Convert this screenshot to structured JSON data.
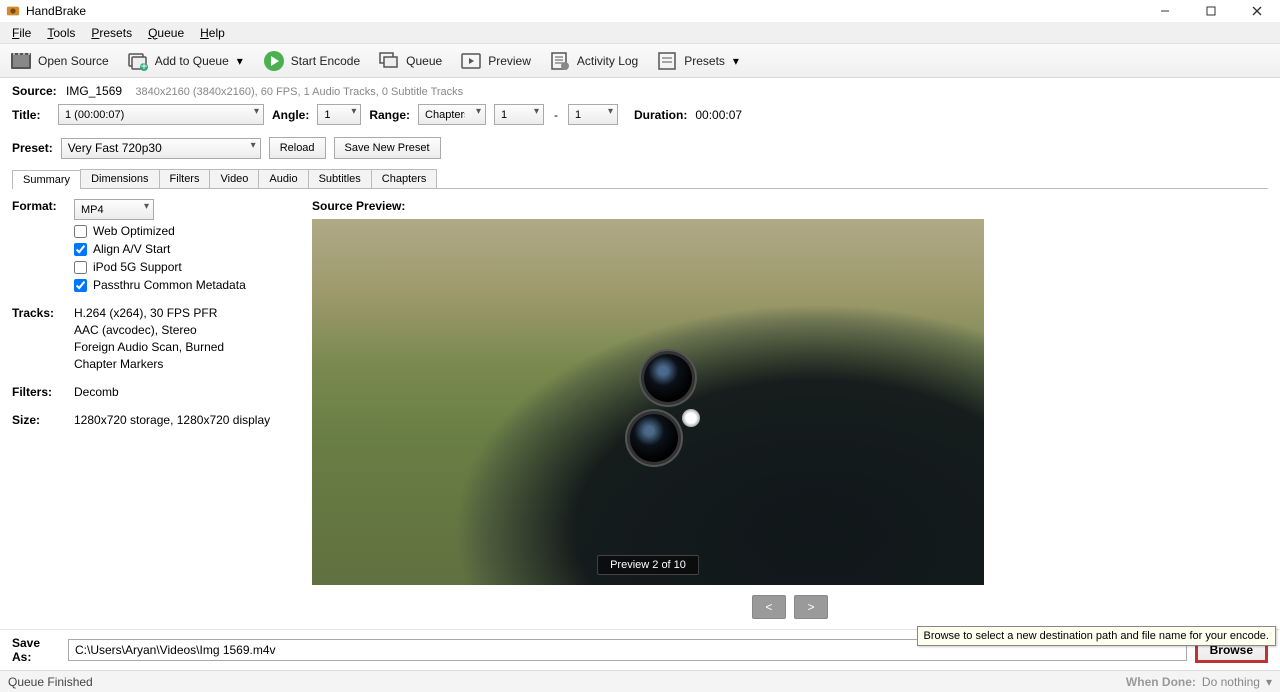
{
  "app": {
    "title": "HandBrake"
  },
  "menu": {
    "file": "File",
    "tools": "Tools",
    "presets": "Presets",
    "queue": "Queue",
    "help": "Help"
  },
  "toolbar": {
    "open_source": "Open Source",
    "add_to_queue": "Add to Queue",
    "start_encode": "Start Encode",
    "queue": "Queue",
    "preview": "Preview",
    "activity_log": "Activity Log",
    "presets": "Presets"
  },
  "source": {
    "label": "Source:",
    "file": "IMG_1569",
    "meta": "3840x2160 (3840x2160), 60 FPS, 1 Audio Tracks, 0 Subtitle Tracks"
  },
  "title_row": {
    "title_label": "Title:",
    "title_value": "1  (00:00:07)",
    "angle_label": "Angle:",
    "angle_value": "1",
    "range_label": "Range:",
    "range_type": "Chapters",
    "range_from": "1",
    "range_dash": "-",
    "range_to": "1",
    "duration_label": "Duration:",
    "duration_value": "00:00:07"
  },
  "preset_row": {
    "label": "Preset:",
    "value": "Very Fast 720p30",
    "reload": "Reload",
    "save_new": "Save New Preset"
  },
  "tabs": {
    "summary": "Summary",
    "dimensions": "Dimensions",
    "filters": "Filters",
    "video": "Video",
    "audio": "Audio",
    "subtitles": "Subtitles",
    "chapters": "Chapters"
  },
  "summary": {
    "format_label": "Format:",
    "format_value": "MP4",
    "web_optimized": "Web Optimized",
    "align_av": "Align A/V Start",
    "ipod_5g": "iPod 5G Support",
    "passthru_meta": "Passthru Common Metadata",
    "tracks_label": "Tracks:",
    "track_video": "H.264 (x264), 30 FPS PFR",
    "track_audio": "AAC (avcodec), Stereo",
    "track_foreign": "Foreign Audio Scan, Burned",
    "track_chapters": "Chapter Markers",
    "filters_label": "Filters:",
    "filters_value": "Decomb",
    "size_label": "Size:",
    "size_value": "1280x720 storage, 1280x720 display"
  },
  "preview": {
    "label": "Source Preview:",
    "badge": "Preview 2 of 10",
    "prev": "<",
    "next": ">"
  },
  "saveas": {
    "label": "Save As:",
    "path": "C:\\Users\\Aryan\\Videos\\Img 1569.m4v",
    "browse": "Browse",
    "tooltip": "Browse to select a new destination path and file name for your encode."
  },
  "status": {
    "left": "Queue Finished",
    "when_done_label": "When Done:",
    "when_done_value": "Do nothing"
  }
}
